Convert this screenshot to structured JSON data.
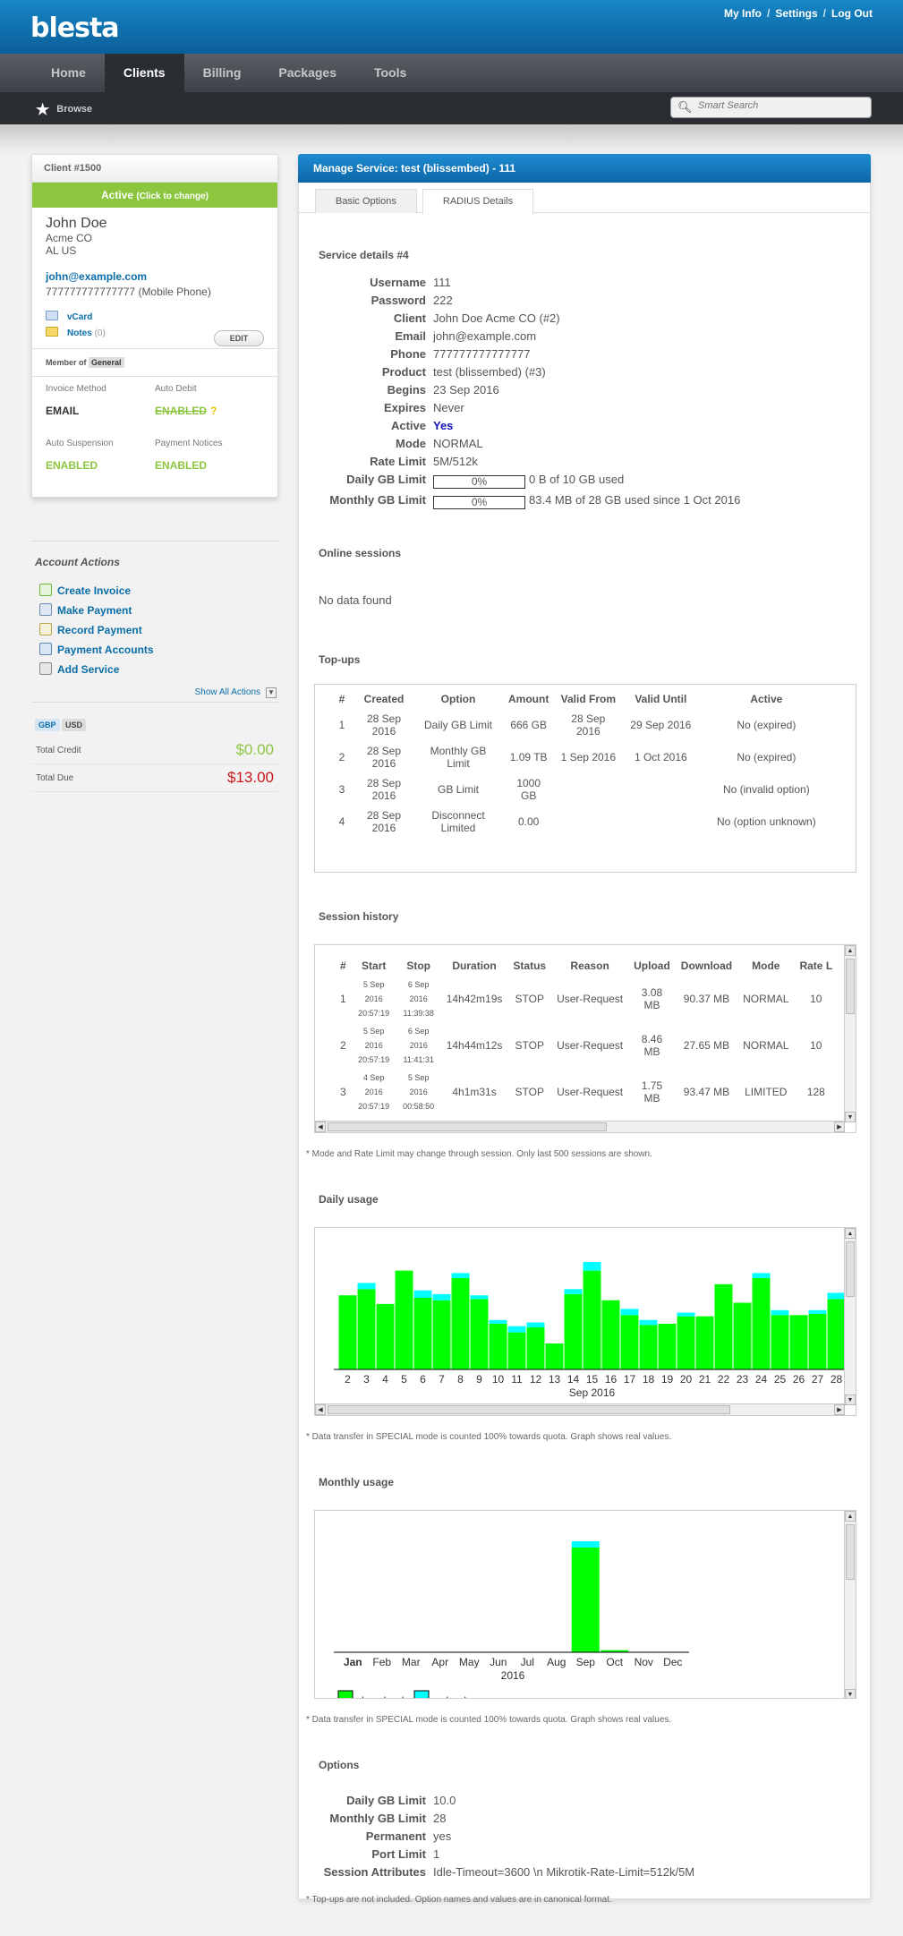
{
  "brand": {
    "logo": "blesta"
  },
  "toplinks": [
    "My Info",
    "Settings",
    "Log Out"
  ],
  "mainnav": [
    "Home",
    "Clients",
    "Billing",
    "Packages",
    "Tools"
  ],
  "subnav": {
    "browse": "Browse",
    "search_placeholder": "Smart Search"
  },
  "client": {
    "title": "Client #1500",
    "status": "Active",
    "status_hint": "(Click to change)",
    "name": "John Doe",
    "company": "Acme CO",
    "location": "AL US",
    "email": "john@example.com",
    "phone": "777777777777777 (Mobile Phone)",
    "vcard": "vCard",
    "notes": "Notes",
    "notes_count": "(0)",
    "edit": "EDIT",
    "member_of": "Member of",
    "group": "General",
    "settings": [
      {
        "label": "Invoice Method",
        "value": "EMAIL"
      },
      {
        "label": "Auto Debit",
        "value": "ENABLED",
        "extra": "?"
      },
      {
        "label": "Auto Suspension",
        "value": "ENABLED"
      },
      {
        "label": "Payment Notices",
        "value": "ENABLED"
      }
    ]
  },
  "account_actions": {
    "title": "Account Actions",
    "items": [
      "Create Invoice",
      "Make Payment",
      "Record Payment",
      "Payment Accounts",
      "Add Service"
    ],
    "show_all": "Show All Actions"
  },
  "currencies": [
    "GBP",
    "USD"
  ],
  "totals": [
    {
      "label": "Total Credit",
      "value": "$0.00",
      "color": "#8cc63f"
    },
    {
      "label": "Total Due",
      "value": "$13.00",
      "color": "#c4161c"
    }
  ],
  "service": {
    "header": "Manage Service: test (blissembed) - 111",
    "tabs": [
      "Basic Options",
      "RADIUS Details"
    ],
    "details_title": "Service details #4",
    "details": [
      {
        "k": "Username",
        "v": "111"
      },
      {
        "k": "Password",
        "v": "222"
      },
      {
        "k": "Client",
        "v": "John Doe Acme CO (#2)"
      },
      {
        "k": "Email",
        "v": "john@example.com"
      },
      {
        "k": "Phone",
        "v": "777777777777777"
      },
      {
        "k": "Product",
        "v": "test (blissembed) (#3)"
      },
      {
        "k": "Begins",
        "v": "23 Sep 2016"
      },
      {
        "k": "Expires",
        "v": "Never"
      },
      {
        "k": "Active",
        "v": "Yes"
      },
      {
        "k": "Mode",
        "v": "NORMAL"
      },
      {
        "k": "Rate Limit",
        "v": "5M/512k"
      }
    ],
    "daily_limit": {
      "k": "Daily GB Limit",
      "pct": "0%",
      "fraction": 0,
      "text": "0 B of 10 GB used"
    },
    "monthly_limit": {
      "k": "Monthly GB Limit",
      "pct": "0%",
      "fraction": 0,
      "text": "83.4 MB of 28 GB used since 1 Oct 2016"
    },
    "online_title": "Online sessions",
    "online_empty": "No data found",
    "topups_title": "Top-ups",
    "topups_headers": [
      "#",
      "Created",
      "Option",
      "Amount",
      "Valid From",
      "Valid Until",
      "Active"
    ],
    "topups": [
      [
        "1",
        "28 Sep 2016",
        "Daily GB Limit",
        "666 GB",
        "28 Sep 2016",
        "29 Sep 2016",
        "No (expired)"
      ],
      [
        "2",
        "28 Sep 2016",
        "Monthly GB Limit",
        "1.09 TB",
        "1 Sep 2016",
        "1 Oct 2016",
        "No (expired)"
      ],
      [
        "3",
        "28 Sep 2016",
        "GB Limit",
        "1000 GB",
        "",
        "",
        "No (invalid option)"
      ],
      [
        "4",
        "28 Sep 2016",
        "Disconnect Limited",
        "0.00",
        "",
        "",
        "No (option unknown)"
      ]
    ],
    "history_title": "Session history",
    "history_headers": [
      "#",
      "Start",
      "Stop",
      "Duration",
      "Status",
      "Reason",
      "Upload",
      "Download",
      "Mode",
      "Rate L"
    ],
    "history": [
      [
        "1",
        "5 Sep 2016 20:57:19",
        "6 Sep 2016 11:39:38",
        "14h42m19s",
        "STOP",
        "User-Request",
        "3.08 MB",
        "90.37 MB",
        "NORMAL",
        "10"
      ],
      [
        "2",
        "5 Sep 2016 20:57:19",
        "6 Sep 2016 11:41:31",
        "14h44m12s",
        "STOP",
        "User-Request",
        "8.46 MB",
        "27.65 MB",
        "NORMAL",
        "10"
      ],
      [
        "3",
        "4 Sep 2016 20:57:19",
        "5 Sep 2016 00:58:50",
        "4h1m31s",
        "STOP",
        "User-Request",
        "1.75 MB",
        "93.47 MB",
        "LIMITED",
        "128"
      ]
    ],
    "history_note": "* Mode and Rate Limit may change through session. Only last 500 sessions are shown.",
    "daily_title": "Daily usage",
    "daily_note": "* Data transfer in SPECIAL mode is counted 100% towards quota. Graph shows real values.",
    "monthly_title": "Monthly usage",
    "monthly_note": "* Data transfer in SPECIAL mode is counted 100% towards quota. Graph shows real values.",
    "options_title": "Options",
    "options": [
      {
        "k": "Daily GB Limit",
        "v": "10.0"
      },
      {
        "k": "Monthly GB Limit",
        "v": "28"
      },
      {
        "k": "Permanent",
        "v": "yes"
      },
      {
        "k": "Port Limit",
        "v": "1"
      },
      {
        "k": "Session Attributes",
        "v": "Idle-Timeout=3600 \\n Mikrotik-Rate-Limit=512k/5M"
      }
    ],
    "options_note": "* Top-ups are not included. Option names and values are in canonical format."
  },
  "chart_data": [
    {
      "type": "bar",
      "xlabel": "Sep 2016",
      "categories": [
        "2",
        "3",
        "4",
        "5",
        "6",
        "7",
        "8",
        "9",
        "10",
        "11",
        "12",
        "13",
        "14",
        "15",
        "16",
        "17",
        "18",
        "19",
        "20",
        "21",
        "22",
        "23",
        "24",
        "25",
        "26",
        "27",
        "28"
      ],
      "series": [
        {
          "name": "download",
          "color": "#00ff00",
          "values": [
            60,
            65,
            53,
            80,
            58,
            56,
            74,
            57,
            37,
            30,
            34,
            21,
            61,
            80,
            56,
            44,
            36,
            37,
            43,
            43,
            69,
            54,
            74,
            44,
            44,
            45,
            57
          ]
        },
        {
          "name": "upload",
          "color": "#00ffff",
          "values": [
            0,
            5,
            0,
            0,
            6,
            5,
            4,
            3,
            3,
            5,
            4,
            0,
            4,
            7,
            0,
            5,
            4,
            0,
            3,
            0,
            0,
            0,
            4,
            4,
            0,
            3,
            5
          ]
        }
      ]
    },
    {
      "type": "bar",
      "xlabel": "2016",
      "categories": [
        "Jan",
        "Feb",
        "Mar",
        "Apr",
        "May",
        "Jun",
        "Jul",
        "Aug",
        "Sep",
        "Oct",
        "Nov",
        "Dec"
      ],
      "series": [
        {
          "name": "download",
          "color": "#00ff00",
          "values": [
            0,
            0,
            0,
            0,
            0,
            0,
            0,
            0,
            100,
            2,
            0,
            0
          ]
        },
        {
          "name": "upload",
          "color": "#00ffff",
          "values": [
            0,
            0,
            0,
            0,
            0,
            0,
            0,
            0,
            6,
            0,
            0,
            0
          ]
        }
      ],
      "legend": [
        "download",
        "upload"
      ]
    }
  ]
}
